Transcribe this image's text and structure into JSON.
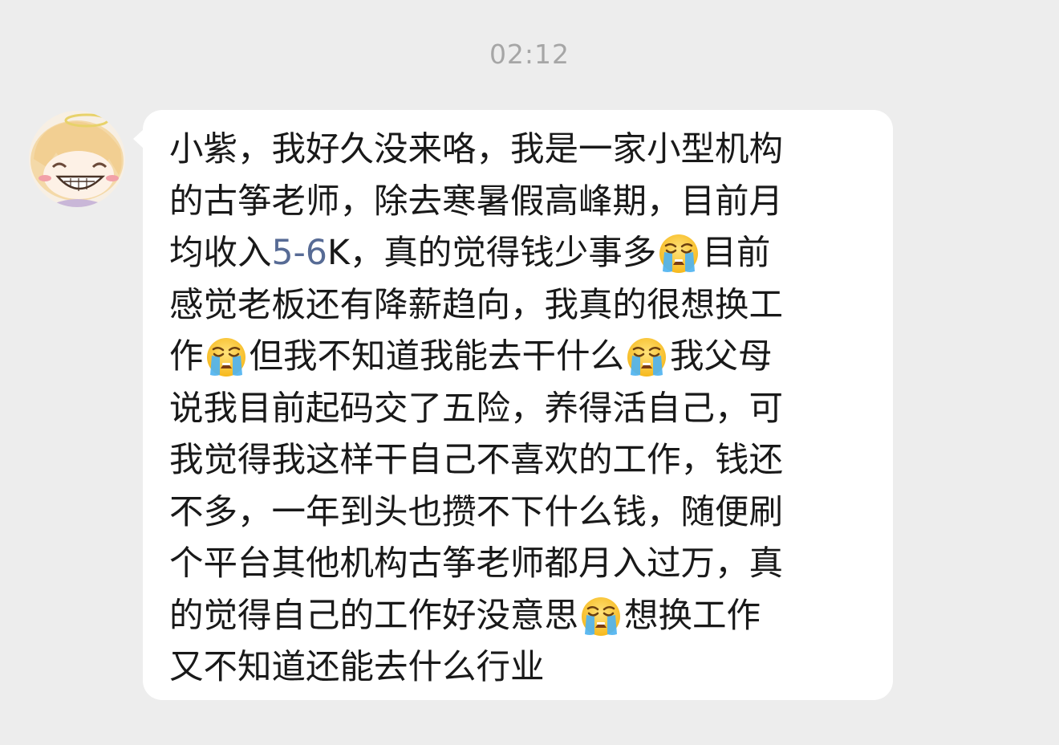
{
  "timestamp": "02:12",
  "sender": {
    "avatar_icon": "cartoon-angel-avatar-icon"
  },
  "message": {
    "emoji": "loudly-crying-face",
    "lines": [
      [
        {
          "t": "小紫，我好久没来咯，我是一家小型机构"
        }
      ],
      [
        {
          "t": "的古筝老师，除去寒暑假高峰期，目前月"
        }
      ],
      [
        {
          "t": "均收入"
        },
        {
          "t": "5-6",
          "link": true
        },
        {
          "t": "K，真的觉得钱少事多"
        },
        {
          "emoji": true
        },
        {
          "t": "目前"
        }
      ],
      [
        {
          "t": "感觉老板还有降薪趋向，我真的很想换工"
        }
      ],
      [
        {
          "t": "作"
        },
        {
          "emoji": true
        },
        {
          "t": "但我不知道我能去干什么"
        },
        {
          "emoji": true
        },
        {
          "t": "我父母"
        }
      ],
      [
        {
          "t": "说我目前起码交了五险，养得活自己，可"
        }
      ],
      [
        {
          "t": "我觉得我这样干自己不喜欢的工作，钱还"
        }
      ],
      [
        {
          "t": "不多，一年到头也攒不下什么钱，随便刷"
        }
      ],
      [
        {
          "t": "个平台其他机构古筝老师都月入过万，真"
        }
      ],
      [
        {
          "t": "的觉得自己的工作好没意思"
        },
        {
          "emoji": true
        },
        {
          "t": "想换工作"
        }
      ],
      [
        {
          "t": "又不知道还能去什么行业"
        }
      ]
    ]
  }
}
